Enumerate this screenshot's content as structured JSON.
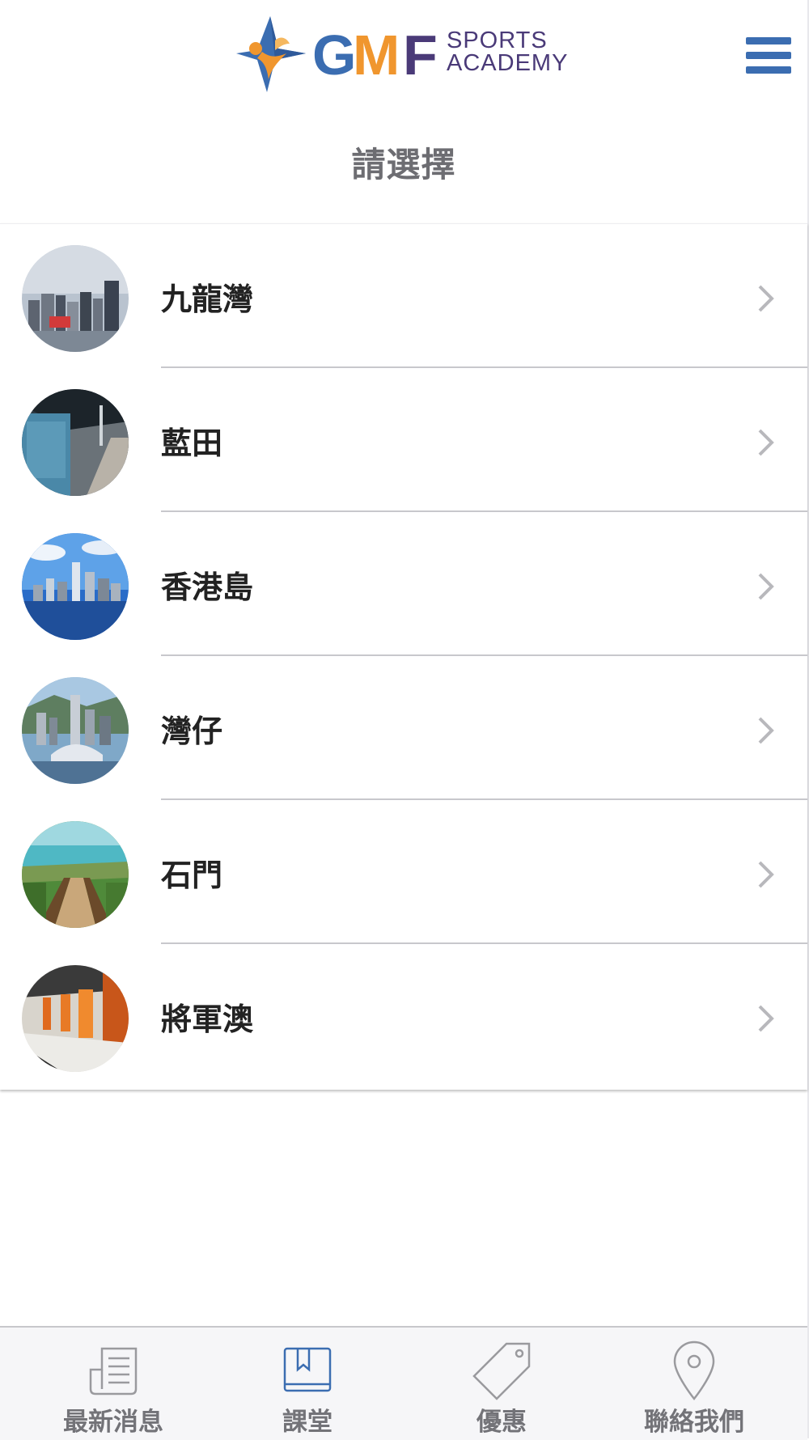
{
  "header": {
    "logo_text": "GMF",
    "logo_sub1": "SPORTS",
    "logo_sub2": "ACADEMY"
  },
  "page_title": "請選擇",
  "locations": [
    {
      "label": "九龍灣",
      "image": "kowloon-bay-skyline"
    },
    {
      "label": "藍田",
      "image": "lam-tin-station"
    },
    {
      "label": "香港島",
      "image": "hong-kong-island-harbour"
    },
    {
      "label": "灣仔",
      "image": "wan-chai-convention-centre"
    },
    {
      "label": "石門",
      "image": "shek-mun-boardwalk"
    },
    {
      "label": "將軍澳",
      "image": "tseung-kwan-o-station"
    }
  ],
  "tabs": [
    {
      "label": "最新消息",
      "icon": "newspaper-icon"
    },
    {
      "label": "課堂",
      "icon": "book-icon"
    },
    {
      "label": "優惠",
      "icon": "tag-icon"
    },
    {
      "label": "聯絡我們",
      "icon": "location-pin-icon"
    }
  ],
  "colors": {
    "brand_blue": "#3b6db1",
    "brand_orange": "#f0962e",
    "brand_purple": "#4a3a78",
    "tab_inactive": "#9a9a9e",
    "text_dark": "#222222"
  }
}
